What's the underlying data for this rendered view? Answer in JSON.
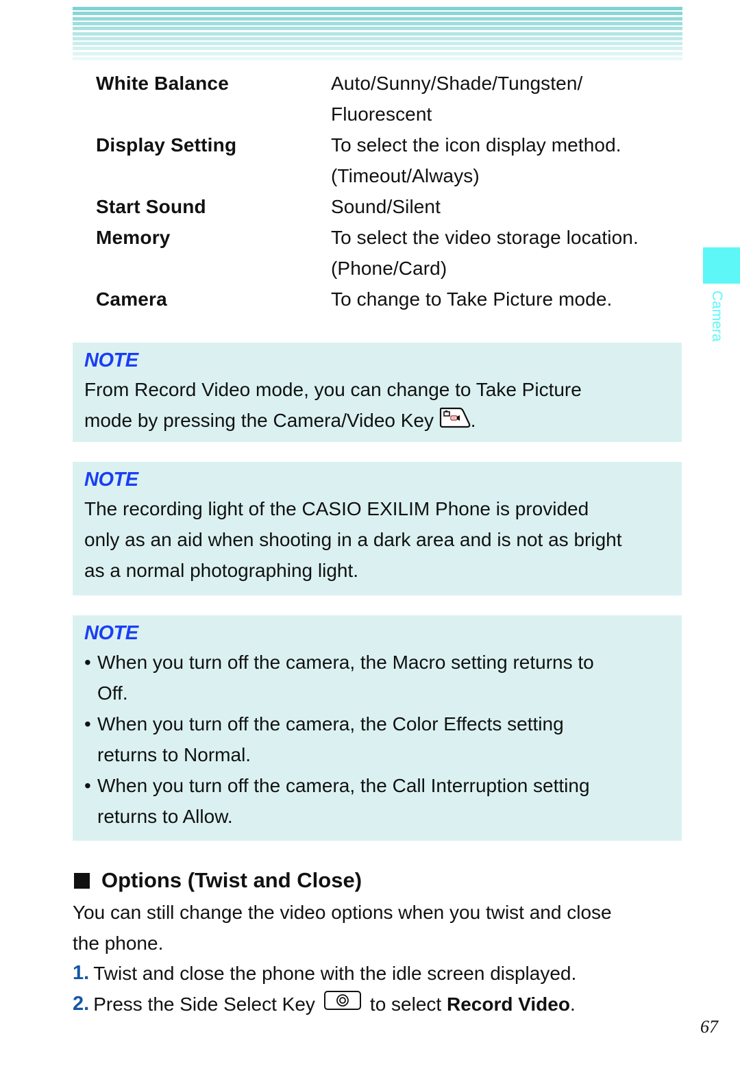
{
  "header": {
    "stripe_color": "#7fd3d3"
  },
  "settings": [
    {
      "label": "White Balance",
      "value_lines": [
        "Auto/Sunny/Shade/Tungsten/",
        "Fluorescent"
      ]
    },
    {
      "label": "Display Setting",
      "value_lines": [
        "To select the icon display method.",
        "(Timeout/Always)"
      ]
    },
    {
      "label": "Start Sound",
      "value_lines": [
        "Sound/Silent"
      ]
    },
    {
      "label": "Memory",
      "value_lines": [
        "To select the video storage location.",
        "(Phone/Card)"
      ]
    },
    {
      "label": "Camera",
      "value_lines": [
        "To change to Take Picture mode."
      ]
    }
  ],
  "side_tab": {
    "label": "Camera",
    "color": "#5ef7f7"
  },
  "notes": [
    {
      "title": "NOTE",
      "lines": [
        "From Record Video mode, you can change to Take Picture",
        "mode by pressing the Camera/Video Key"
      ],
      "trailing": ".",
      "icon": "camera-video-key-icon"
    },
    {
      "title": "NOTE",
      "lines": [
        "The recording light of the CASIO EXILIM Phone is provided",
        "only as an aid when shooting in a dark area and is not as bright",
        "as a normal photographing light."
      ]
    },
    {
      "title": "NOTE",
      "bullets": [
        {
          "lines": [
            "When you turn off the camera, the Macro setting returns to",
            "Off."
          ]
        },
        {
          "lines": [
            "When you turn off the camera, the Color Effects setting",
            "returns to Normal."
          ]
        },
        {
          "lines": [
            "When you turn off the camera, the Call Interruption setting",
            "returns to Allow."
          ]
        }
      ]
    }
  ],
  "section": {
    "title": "Options (Twist and Close)",
    "intro_lines": [
      "You can still change the video options when you twist and close",
      "the phone."
    ],
    "steps": [
      {
        "num": "1.",
        "text": "Twist and close the phone with the idle screen displayed."
      },
      {
        "num": "2.",
        "text_before": "Press the Side Select Key",
        "icon": "side-select-key-icon",
        "text_middle": "to select",
        "bold": "Record Video",
        "text_after": "."
      }
    ]
  },
  "page_number": "67",
  "colors": {
    "note_bg": "#dbf1f1",
    "note_title": "#1a3ef5",
    "step_number": "#1457a8"
  }
}
